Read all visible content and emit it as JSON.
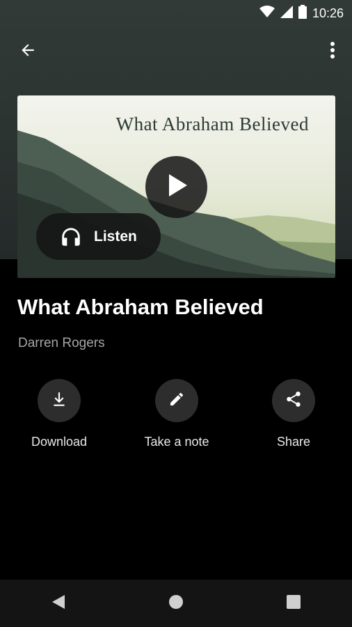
{
  "status_bar": {
    "time": "10:26"
  },
  "episode": {
    "artwork_title": "What Abraham Believed",
    "listen_label": "Listen",
    "title": "What Abraham Believed",
    "author": "Darren Rogers"
  },
  "actions": {
    "download_label": "Download",
    "note_label": "Take a note",
    "share_label": "Share"
  },
  "icons": [
    "back-arrow-icon",
    "more-vert-icon",
    "play-icon",
    "headphones-icon",
    "download-icon",
    "pencil-icon",
    "share-icon",
    "nav-back-icon",
    "nav-home-icon",
    "nav-recents-icon",
    "wifi-icon",
    "signal-icon",
    "battery-icon"
  ],
  "colors": {
    "background": "#000000",
    "header_bg": "#2c3432",
    "action_circle": "#2d2d2d",
    "secondary_text": "#a6a6a6"
  }
}
